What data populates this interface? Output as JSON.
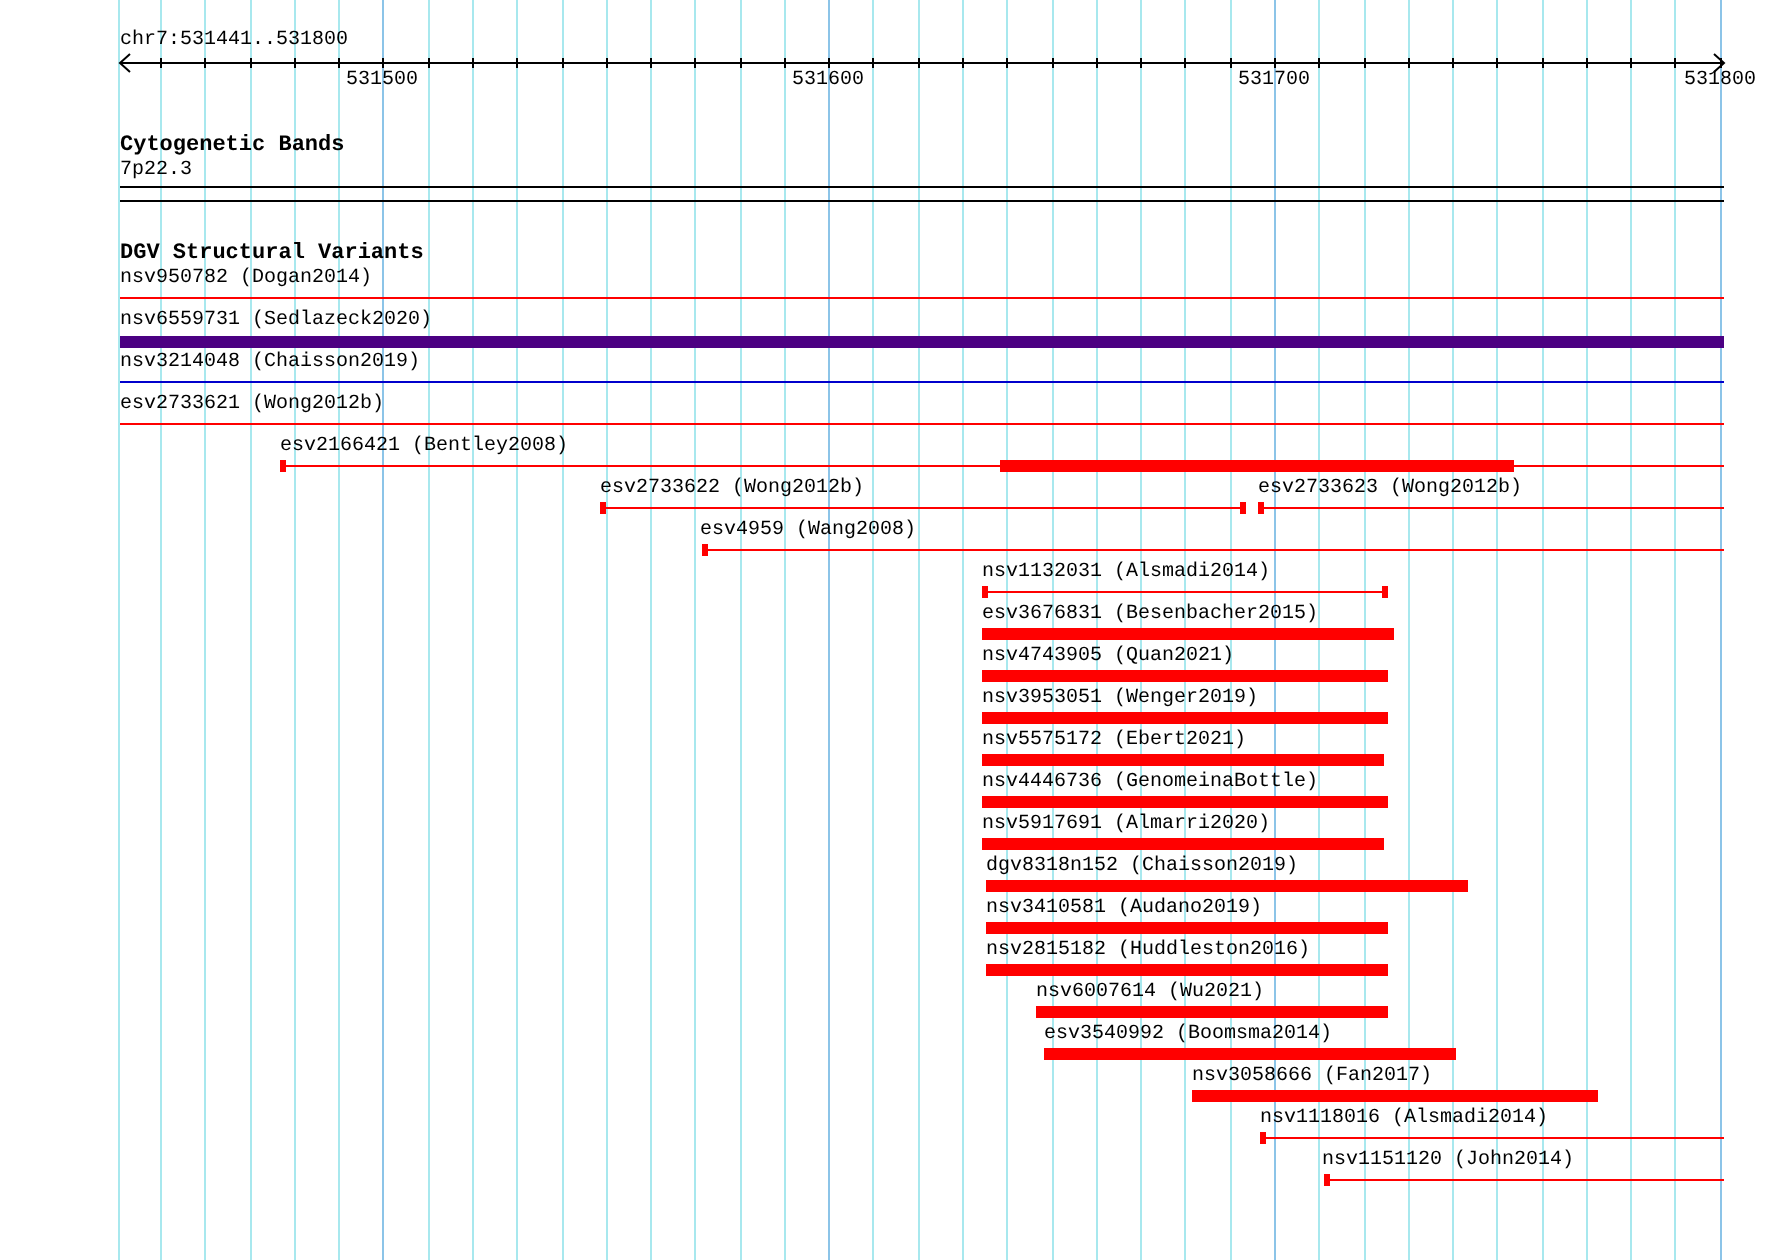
{
  "ruler": {
    "region_label": "chr7:531441..531800",
    "tick_labels": [
      "531500",
      "531600",
      "531700",
      "531800"
    ]
  },
  "cytoband_track": {
    "title": "Cytogenetic Bands",
    "band": "7p22.3"
  },
  "variant_track": {
    "title": "DGV Structural Variants",
    "features": [
      {
        "label": "nsv950782 (Dogan2014)",
        "kind": "line",
        "color": "#ff0000"
      },
      {
        "label": "nsv6559731 (Sedlazeck2020)",
        "kind": "bar",
        "color": "#4b0082"
      },
      {
        "label": "nsv3214048 (Chaisson2019)",
        "kind": "line",
        "color": "#0000cc"
      },
      {
        "label": "esv2733621 (Wong2012b)",
        "kind": "line",
        "color": "#ff0000"
      },
      {
        "label": "esv2166421 (Bentley2008)",
        "kind": "line",
        "color": "#ff0000"
      },
      {
        "label": "esv2733622 (Wong2012b)",
        "kind": "line",
        "color": "#ff0000"
      },
      {
        "label": "esv2733623 (Wong2012b)",
        "kind": "line",
        "color": "#ff0000"
      },
      {
        "label": "esv4959 (Wang2008)",
        "kind": "line",
        "color": "#ff0000"
      },
      {
        "label": "nsv1132031 (Alsmadi2014)",
        "kind": "line",
        "color": "#ff0000"
      },
      {
        "label": "esv3676831 (Besenbacher2015)",
        "kind": "bar",
        "color": "#ff0000"
      },
      {
        "label": "nsv4743905 (Quan2021)",
        "kind": "bar",
        "color": "#ff0000"
      },
      {
        "label": "nsv3953051 (Wenger2019)",
        "kind": "bar",
        "color": "#ff0000"
      },
      {
        "label": "nsv5575172 (Ebert2021)",
        "kind": "bar",
        "color": "#ff0000"
      },
      {
        "label": "nsv4446736 (GenomeinaBottle)",
        "kind": "bar",
        "color": "#ff0000"
      },
      {
        "label": "nsv5917691 (Almarri2020)",
        "kind": "bar",
        "color": "#ff0000"
      },
      {
        "label": "dgv8318n152 (Chaisson2019)",
        "kind": "bar",
        "color": "#ff0000"
      },
      {
        "label": "nsv3410581 (Audano2019)",
        "kind": "bar",
        "color": "#ff0000"
      },
      {
        "label": "nsv2815182 (Huddleston2016)",
        "kind": "bar",
        "color": "#ff0000"
      },
      {
        "label": "nsv6007614 (Wu2021)",
        "kind": "bar",
        "color": "#ff0000"
      },
      {
        "label": "esv3540992 (Boomsma2014)",
        "kind": "bar",
        "color": "#ff0000"
      },
      {
        "label": "nsv3058666 (Fan2017)",
        "kind": "bar",
        "color": "#ff0000"
      },
      {
        "label": "nsv1118016 (Alsmadi2014)",
        "kind": "line",
        "color": "#ff0000"
      },
      {
        "label": "nsv1151120 (John2014)",
        "kind": "line",
        "color": "#ff0000"
      }
    ]
  }
}
